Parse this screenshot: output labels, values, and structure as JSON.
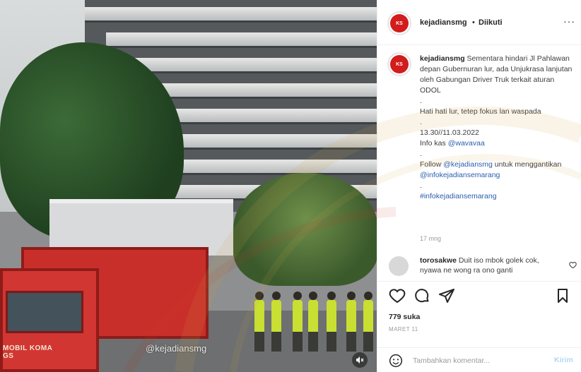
{
  "media": {
    "watermark": "@kejadiansmg",
    "truck_label": "MOBIL KOMA",
    "truck_plate": "GS"
  },
  "header": {
    "username": "kejadiansmg",
    "separator": "•",
    "follow_status": "Diikuti",
    "more": "···"
  },
  "caption": {
    "username": "kejadiansmg",
    "text": "Sementara hindari Jl Pahlawan depan Gubernuran lur, ada Unjukrasa lanjutan oleh Gabungan Driver Truk terkait aturan ODOL",
    "dot1": ".",
    "line2": "Hati hati lur, tetep fokus lan waspada",
    "dot2": ".",
    "line3": "13.30//11.03.2022",
    "info_prefix": "Info kas",
    "info_handle": "@wavavaa",
    "dot3": ".",
    "follow_prefix": "Follow",
    "follow_handle": "@kejadiansmg",
    "follow_suffix": "untuk menggantikan",
    "info_account": "@infokejadiansemarang",
    "dot4": ".",
    "hashtag": "#infokejadiansemarang",
    "time_ago": "17 mng"
  },
  "comment": {
    "username": "torosakwe",
    "text": "Duit iso mbok golek cok, nyawa ne wong ra ono ganti"
  },
  "likes": "779 suka",
  "date": "MARET 11",
  "comment_input": {
    "placeholder": "Tambahkan komentar...",
    "post_label": "Kirim"
  },
  "icons": {
    "avatar": "kejadiansmg-logo-icon",
    "like": "heart-icon",
    "comment": "comment-icon",
    "share": "send-icon",
    "save": "bookmark-icon",
    "emoji": "emoji-icon",
    "volume": "volume-muted-icon"
  },
  "colors": {
    "brand_red": "#d31c1c",
    "link": "#2a5db0",
    "post_button": "#b3d7f5"
  }
}
